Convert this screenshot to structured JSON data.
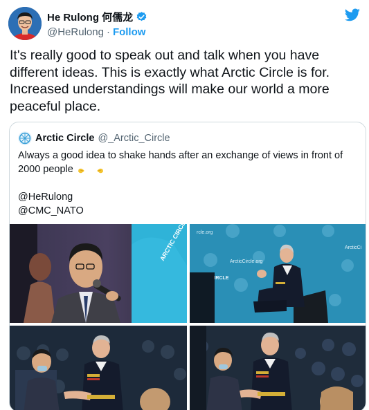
{
  "author": {
    "display_name": "He Rulong 何儒龙",
    "handle": "@HeRulong",
    "separator": "·",
    "follow_label": "Follow"
  },
  "tweet": {
    "lines": [
      "It's really good to speak out and talk when you have",
      "different ideas. This is exactly what Arctic Circle is for.",
      "Increased understandings will make our world a more",
      "peaceful place."
    ]
  },
  "quoted": {
    "display_name": "Arctic Circle",
    "handle": "@_Arctic_Circle",
    "lines": [
      "Always a good idea to shake hands after an exchange of views in front of",
      "2000 people",
      "",
      "@HeRulong",
      "@CMC_NATO"
    ],
    "photo_texts": {
      "shirt_text": "ARCTIC CIRCLE",
      "backdrop_site": "ArcticCircle.org",
      "backdrop_logo": "ARCTIC CIRCLE",
      "backdrop_side": "ArcticCi",
      "backdrop_top": "rcle.org"
    }
  },
  "icons": {
    "verified": "verified-badge-icon",
    "twitter": "twitter-bird-icon",
    "hands": "handshake-hands-icon"
  },
  "colors": {
    "accent": "#1d9bf0",
    "text": "#0f1419",
    "muted": "#536471",
    "border": "#cfd9de",
    "stage_blue": "#2a8fb6"
  }
}
